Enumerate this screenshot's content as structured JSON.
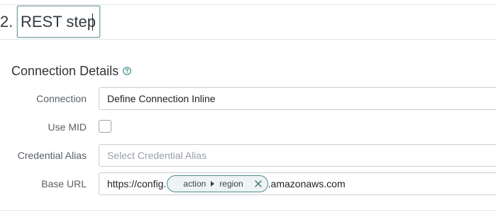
{
  "step": {
    "number": "2.",
    "name": "REST step"
  },
  "section": {
    "title": "Connection Details",
    "help_icon": "question-circle-icon"
  },
  "fields": {
    "connection": {
      "label": "Connection",
      "value": "Define Connection Inline"
    },
    "use_mid": {
      "label": "Use MID",
      "checked": false
    },
    "credential_alias": {
      "label": "Credential Alias",
      "placeholder": "Select Credential Alias"
    },
    "base_url": {
      "label": "Base URL",
      "prefix": "https://config.",
      "pill": {
        "segment1": "action",
        "segment2": "region",
        "close_icon": "close-icon"
      },
      "suffix": ".amazonaws.com"
    }
  },
  "colors": {
    "accent": "#4b8e91",
    "input_border": "#c9cdd1",
    "label_text": "#5a6067"
  }
}
